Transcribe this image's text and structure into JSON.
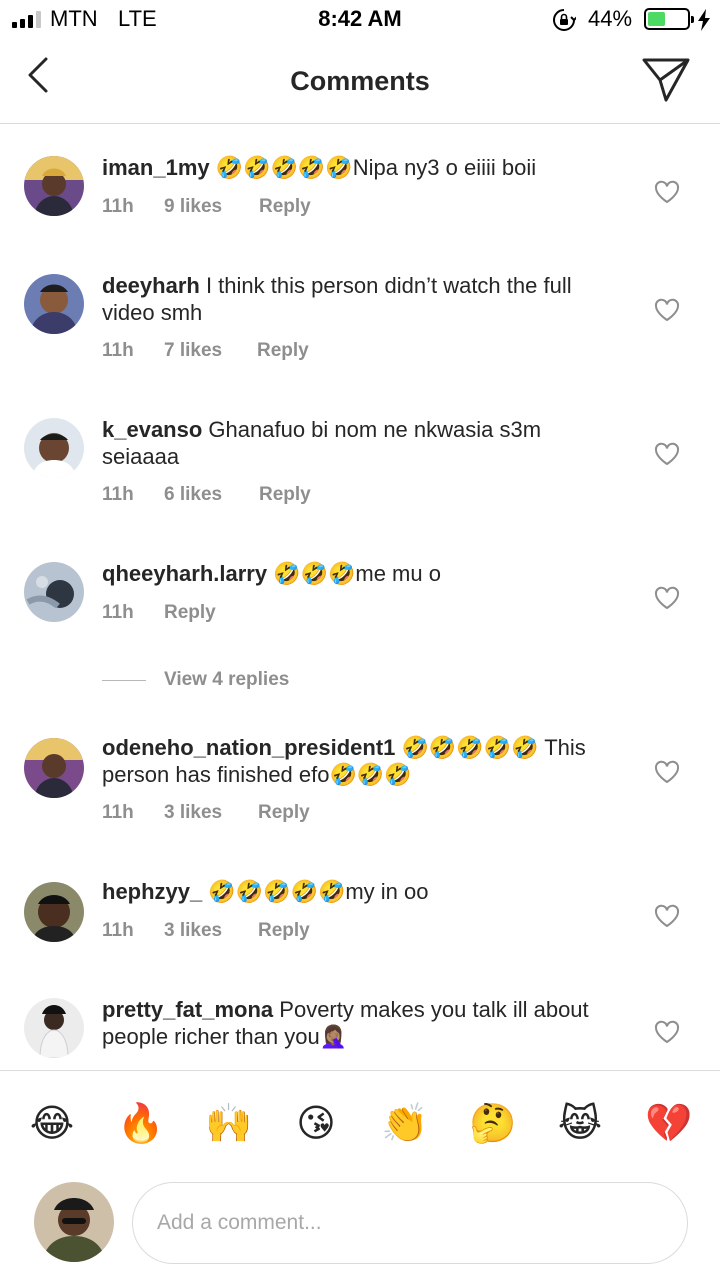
{
  "status_bar": {
    "carrier": "MTN",
    "network": "LTE",
    "time": "8:42 AM",
    "battery_percent": "44%",
    "battery_level": 0.44
  },
  "header": {
    "title": "Comments",
    "back_icon": "chevron-left-icon",
    "send_icon": "paper-plane-icon"
  },
  "comments": [
    {
      "username": "iman_1my",
      "text": "🤣🤣🤣🤣🤣Nipa ny3 o eiiii boii",
      "time": "11h",
      "likes": "9 likes",
      "reply": "Reply"
    },
    {
      "username": "deeyharh",
      "text": "I think this person didn’t watch the full video smh",
      "time": "11h",
      "likes": "7 likes",
      "reply": "Reply"
    },
    {
      "username": "k_evanso",
      "text": "Ghanafuo bi  nom ne nkwasia s3m seiaaaa",
      "time": "11h",
      "likes": "6 likes",
      "reply": "Reply"
    },
    {
      "username": "qheeyharh.larry",
      "text": "🤣🤣🤣me mu o",
      "time": "11h",
      "likes": "",
      "reply": "Reply"
    },
    {
      "username": "odeneho_nation_president1",
      "text": "🤣🤣🤣🤣🤣 This person has finished efo🤣🤣🤣",
      "time": "11h",
      "likes": "3 likes",
      "reply": "Reply"
    },
    {
      "username": "hephzyy_",
      "text": "🤣🤣🤣🤣🤣my in oo",
      "time": "11h",
      "likes": "3 likes",
      "reply": "Reply"
    },
    {
      "username": "pretty_fat_mona",
      "text": "Poverty makes you talk ill about people richer than you🤦🏽‍♀️",
      "time": "",
      "likes": "",
      "reply": ""
    }
  ],
  "view_replies": "View 4 replies",
  "emoji_bar": [
    "😂",
    "🔥",
    "🙌",
    "😘",
    "👏",
    "🤔",
    "😹",
    "💔"
  ],
  "composer": {
    "placeholder": "Add a comment..."
  },
  "colors": {
    "text": "#262626",
    "secondary": "#8e8e8e",
    "divider": "#dbdbdb",
    "battery": "#4cd964"
  }
}
